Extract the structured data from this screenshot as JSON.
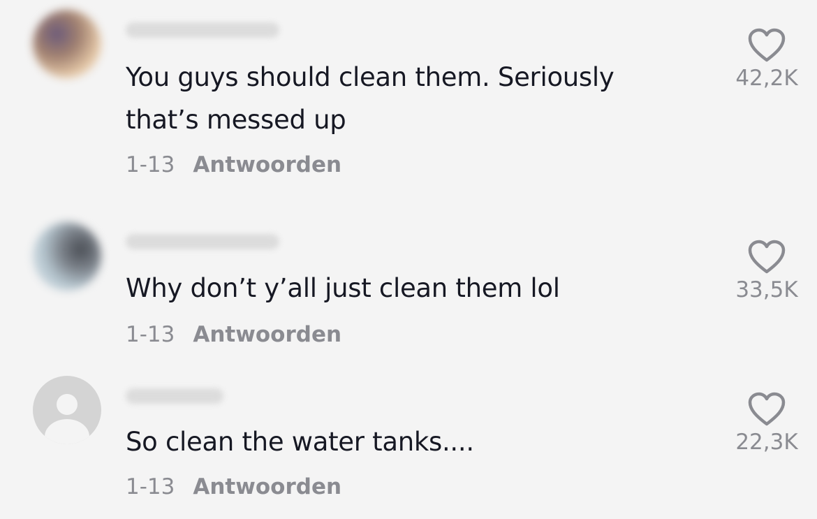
{
  "comments": [
    {
      "text": "You guys should clean them. Seriously that’s messed up",
      "date": "1-13",
      "reply_label": "Antwoorden",
      "likes": "42,2K",
      "avatar": "photo"
    },
    {
      "text": "Why don’t y’all just clean them lol",
      "date": "1-13",
      "reply_label": "Antwoorden",
      "likes": "33,5K",
      "avatar": "photo"
    },
    {
      "text": "So clean the water tanks....",
      "date": "1-13",
      "reply_label": "Antwoorden",
      "likes": "22,3K",
      "avatar": "default-user-icon"
    }
  ],
  "icons": {
    "like": "heart-outline-icon"
  },
  "colors": {
    "background": "#f4f4f4",
    "text": "#161823",
    "secondary": "#8a8b91"
  }
}
